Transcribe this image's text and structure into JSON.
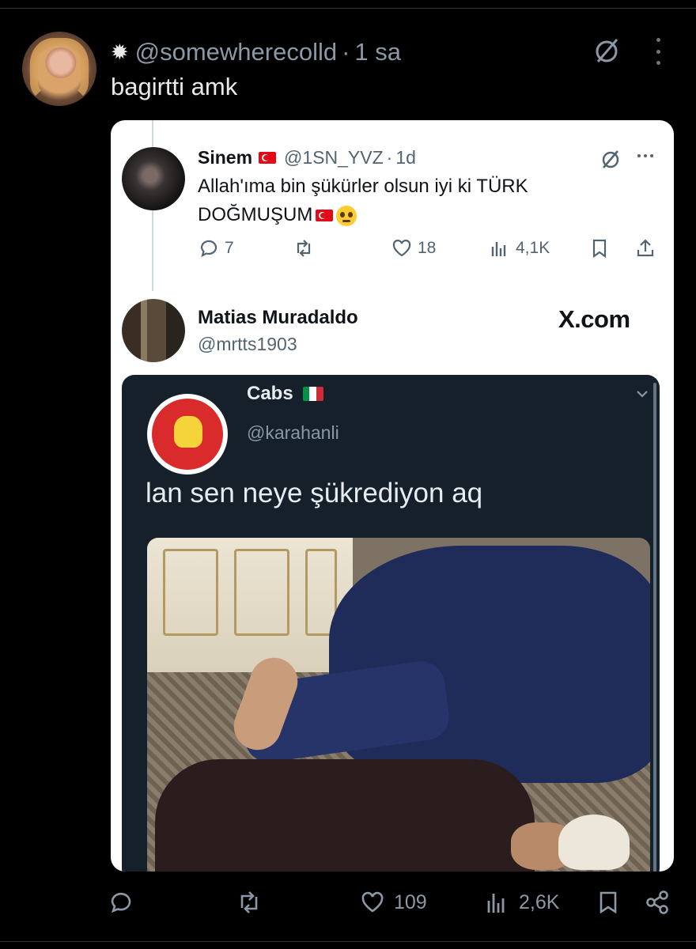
{
  "outer_tweet": {
    "handle": "@somewherecolld",
    "separator": "·",
    "time": "1 sa",
    "text": "bagirtti amk",
    "actions": {
      "replies": "",
      "retweets": "",
      "likes": "109",
      "views": "2,6K"
    }
  },
  "quoted_tweet": {
    "name": "Sinem",
    "handle": "@1SN_YVZ",
    "separator": "·",
    "time": "1d",
    "text_line1": "Allah'ıma bin şükürler olsun iyi ki TÜRK",
    "text_line2": "DOĞMUŞUM",
    "actions": {
      "replies": "7",
      "retweets": "",
      "likes": "18",
      "views": "4,1K"
    }
  },
  "reply_tweet": {
    "name": "Matias Muradaldo",
    "handle": "@mrtts1903",
    "watermark": "X.com"
  },
  "inner_screenshot": {
    "name": "Cabs",
    "handle": "@karahanli",
    "text": "lan sen neye şükrediyon aq"
  },
  "colors": {
    "background": "#000000",
    "card": "#ffffff",
    "dark_card": "#15202b",
    "muted": "#8b98a5",
    "turkish_flag": "#e30a17"
  },
  "icons": [
    "sparkle-icon",
    "grok-icon",
    "more-icon",
    "reply-icon",
    "retweet-icon",
    "like-icon",
    "views-icon",
    "bookmark-icon",
    "share-icon",
    "chevron-down-icon"
  ]
}
